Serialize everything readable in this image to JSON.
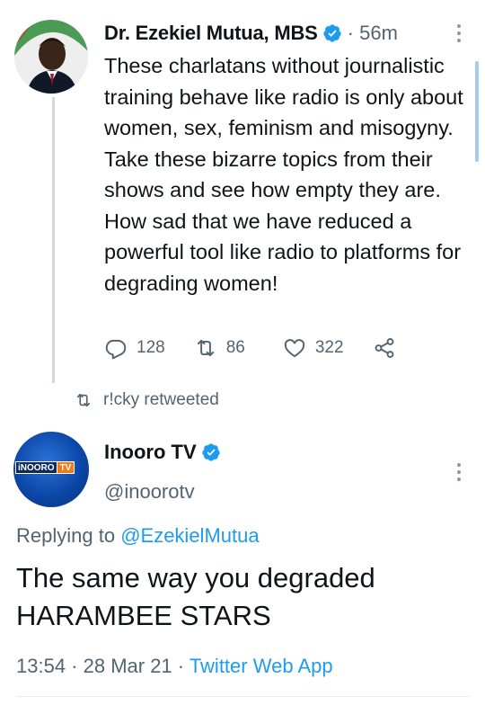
{
  "colors": {
    "accent": "#1d9bf0",
    "text_primary": "#0f1419",
    "text_secondary": "#536471",
    "verified_badge": "#1d9bf0"
  },
  "tweet1": {
    "author_name": "Dr. Ezekiel Mutua, MBS",
    "verified_icon": "verified-badge-icon",
    "separator": "·",
    "time": "56m",
    "text": "These charlatans without journalistic training behave like radio  is only about women, sex, feminism and misogyny. Take these bizarre topics from their shows and see how empty they are. How sad that we have reduced a powerful tool like radio to platforms for degrading women!",
    "actions": {
      "replies": "128",
      "retweets": "86",
      "likes": "322",
      "reply_icon": "reply-icon",
      "retweet_icon": "retweet-icon",
      "like_icon": "heart-icon",
      "share_icon": "share-icon"
    }
  },
  "retweeted_by": {
    "icon": "retweet-icon",
    "text": "r!cky retweeted"
  },
  "tweet2": {
    "author_name": "Inooro TV",
    "handle": "@inoorotv",
    "avatar_logo": {
      "part1": "iNOORO",
      "part2": "TV"
    },
    "replying_prefix": "Replying to ",
    "replying_to": "@EzekielMutua",
    "text_line1": "The same way you degraded",
    "text_line2": "HARAMBEE STARS",
    "timestamp": "13:54 · 28 Mar 21 · ",
    "source_app": "Twitter Web App"
  }
}
